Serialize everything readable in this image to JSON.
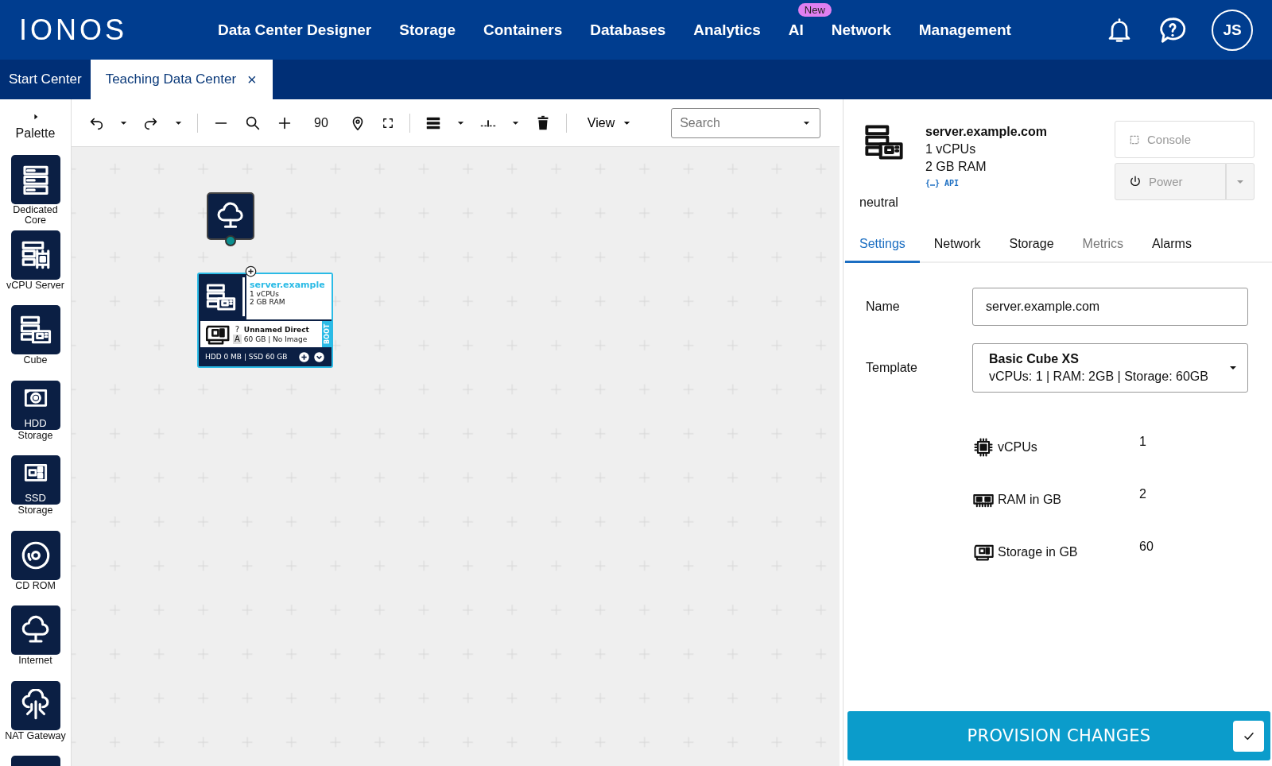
{
  "header": {
    "logo": "IONOS",
    "nav": [
      {
        "label": "Data Center Designer"
      },
      {
        "label": "Storage"
      },
      {
        "label": "Containers"
      },
      {
        "label": "Databases"
      },
      {
        "label": "Analytics"
      },
      {
        "label": "AI",
        "badge": "New"
      },
      {
        "label": "Network"
      },
      {
        "label": "Management"
      }
    ],
    "avatar": "JS"
  },
  "tabs": [
    {
      "label": "Start Center",
      "selected": false
    },
    {
      "label": "Teaching Data Center",
      "selected": true,
      "close": "×"
    }
  ],
  "palette": {
    "title": "Palette",
    "items": [
      {
        "kind": "dedicated",
        "caption": "Dedicated Core"
      },
      {
        "kind": "vcpu",
        "caption": "vCPU Server"
      },
      {
        "kind": "cube",
        "caption": "Cube"
      },
      {
        "kind": "hdd",
        "tile_label": "HDD",
        "caption": "Storage"
      },
      {
        "kind": "ssd",
        "tile_label": "SSD",
        "caption": "Storage"
      },
      {
        "kind": "cdrom",
        "caption": "CD ROM"
      },
      {
        "kind": "internet",
        "caption": "Internet"
      },
      {
        "kind": "nat",
        "caption": "NAT Gateway"
      },
      {
        "kind": "blank"
      }
    ]
  },
  "toolbar": {
    "zoom": "90",
    "view": "View",
    "search": {
      "placeholder": "Search"
    }
  },
  "canvas": {
    "internet_node": {
      "connected": true
    },
    "server_card": {
      "title": "server.example",
      "lines": [
        "1 vCPUs",
        "2 GB RAM"
      ],
      "volume": {
        "mark": "?",
        "letter": "A",
        "name": "Unnamed Direct",
        "detail": "60 GB | No Image",
        "boot": "BOOT"
      },
      "footer": "HDD 0 MB | SSD 60 GB"
    }
  },
  "details": {
    "name": "server.example.com",
    "lines": [
      "1 vCPUs",
      "2 GB RAM"
    ],
    "api": "{…} API",
    "state": "neutral",
    "buttons": [
      {
        "kind": "console",
        "label": "Console",
        "disabled": true
      },
      {
        "kind": "power",
        "label": "Power",
        "disabled": true
      }
    ]
  },
  "detail_tabs": [
    {
      "label": "Settings",
      "selected": true,
      "disabled": false
    },
    {
      "label": "Network",
      "selected": false,
      "disabled": false
    },
    {
      "label": "Storage",
      "selected": false,
      "disabled": false
    },
    {
      "label": "Metrics",
      "selected": false,
      "disabled": true
    },
    {
      "label": "Alarms",
      "selected": false,
      "disabled": false
    }
  ],
  "form": {
    "name": {
      "label": "Name",
      "value": "server.example.com"
    },
    "template": {
      "label": "Template",
      "title": "Basic Cube XS",
      "summary": "vCPUs: 1 | RAM: 2GB | Storage: 60GB"
    },
    "resources": [
      {
        "kind": "cpu",
        "label": "vCPUs",
        "value": "1"
      },
      {
        "kind": "ram",
        "label": "RAM in GB",
        "value": "2"
      },
      {
        "kind": "storage",
        "label": "Storage in GB",
        "value": "60"
      }
    ]
  },
  "provision_button": {
    "label": "PROVISION CHANGES"
  }
}
